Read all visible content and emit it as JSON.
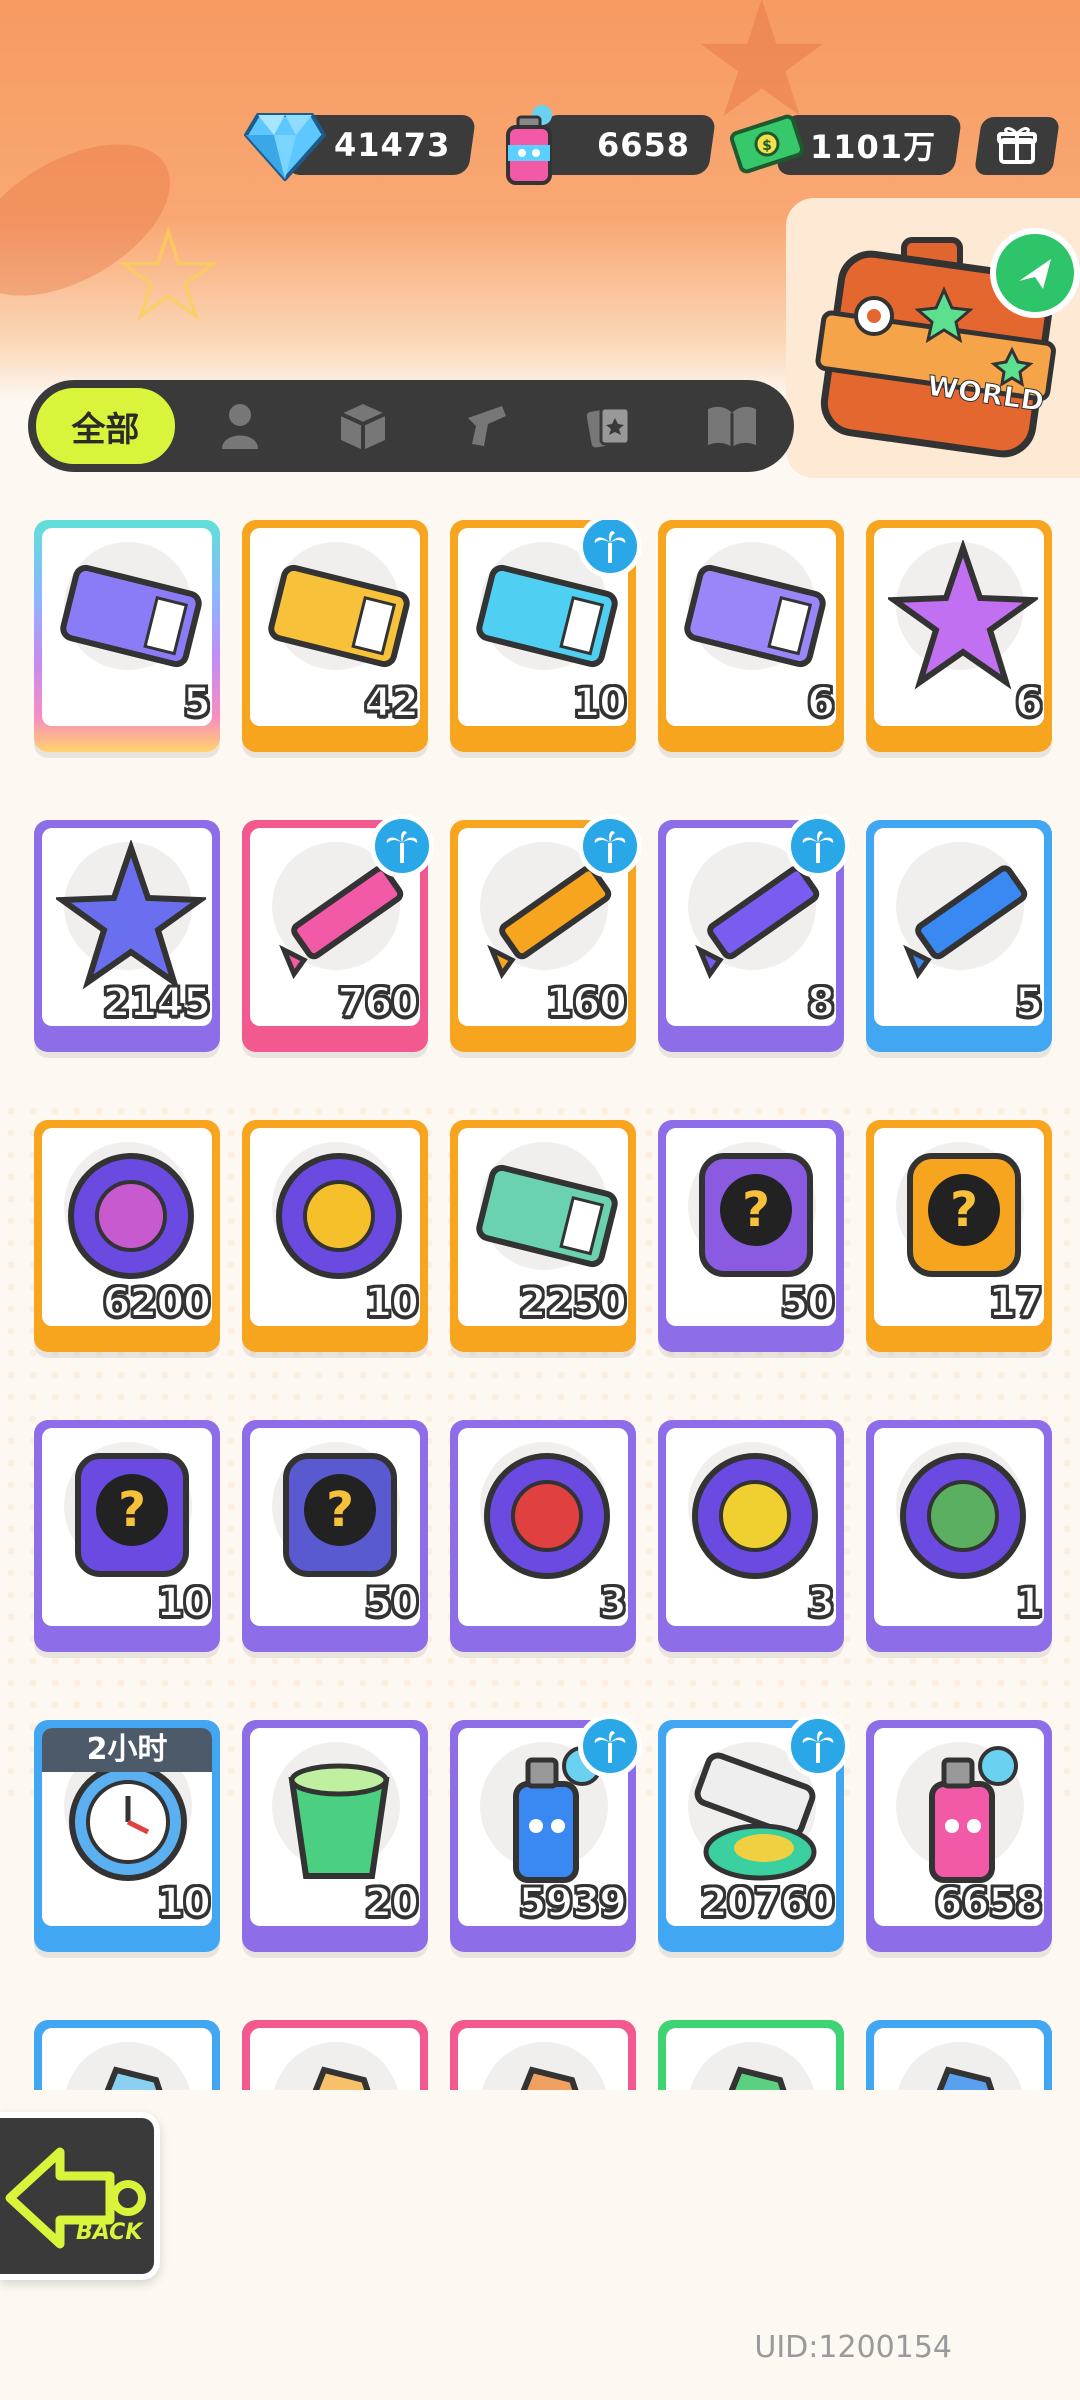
{
  "currencies": [
    {
      "icon": "diamond-icon",
      "value": "41473"
    },
    {
      "icon": "spray-can-icon",
      "value": "6658"
    },
    {
      "icon": "cash-icon",
      "value": "1101万"
    }
  ],
  "tabs": {
    "active_label": "全部",
    "icons": [
      "person-icon",
      "box-icon",
      "gun-icon",
      "cards-icon",
      "book-icon"
    ]
  },
  "world_label": "WORLD",
  "items": [
    {
      "name": "crown-ticket",
      "count": "5",
      "frame": "rainbow",
      "badge": false
    },
    {
      "name": "star-ticket",
      "count": "42",
      "frame": "orange",
      "badge": false
    },
    {
      "name": "wave-up-ticket",
      "count": "10",
      "frame": "orange",
      "badge": true
    },
    {
      "name": "purple-star-ticket",
      "count": "6",
      "frame": "orange",
      "badge": false
    },
    {
      "name": "rainbow-star",
      "count": "6",
      "frame": "orange",
      "badge": false
    },
    {
      "name": "blue-star",
      "count": "2145",
      "frame": "purple",
      "badge": false
    },
    {
      "name": "pink-crayon",
      "count": "760",
      "frame": "pink",
      "badge": true
    },
    {
      "name": "orange-crayon",
      "count": "160",
      "frame": "orange",
      "badge": true
    },
    {
      "name": "purple-crayon",
      "count": "8",
      "frame": "purple",
      "badge": true
    },
    {
      "name": "blue-crayon",
      "count": "5",
      "frame": "blue",
      "badge": false
    },
    {
      "name": "cool-badge",
      "count": "6200",
      "frame": "orange",
      "badge": false
    },
    {
      "name": "explosion-badge",
      "count": "10",
      "frame": "orange",
      "badge": false
    },
    {
      "name": "season-ticket",
      "count": "2250",
      "frame": "orange",
      "badge": false
    },
    {
      "name": "mystery-egg",
      "count": "50",
      "frame": "purple",
      "badge": false
    },
    {
      "name": "deity-mystery-gold",
      "count": "17",
      "frame": "orange",
      "badge": false
    },
    {
      "name": "deity-mystery-purple",
      "count": "10",
      "frame": "purple",
      "badge": false
    },
    {
      "name": "travel-card-mystery",
      "count": "50",
      "frame": "purple",
      "badge": false
    },
    {
      "name": "fish-pet-orb",
      "count": "3",
      "frame": "purple",
      "badge": false
    },
    {
      "name": "yellow-pet-orb",
      "count": "3",
      "frame": "purple",
      "badge": false
    },
    {
      "name": "plant-pet-orb",
      "count": "1",
      "frame": "purple",
      "badge": false
    },
    {
      "name": "alarm-clock",
      "count": "10",
      "frame": "blue",
      "badge": false,
      "timer": "2小时"
    },
    {
      "name": "green-cup",
      "count": "20",
      "frame": "purple",
      "badge": false
    },
    {
      "name": "blue-spray-can",
      "count": "5939",
      "frame": "purple",
      "badge": true
    },
    {
      "name": "paint-tube",
      "count": "20760",
      "frame": "blue",
      "badge": true
    },
    {
      "name": "pink-spray-can",
      "count": "6658",
      "frame": "purple",
      "badge": false
    },
    {
      "name": "partial-item-1",
      "count": "",
      "frame": "blue",
      "badge": false
    },
    {
      "name": "partial-item-2",
      "count": "",
      "frame": "pink",
      "badge": false
    },
    {
      "name": "partial-item-3",
      "count": "",
      "frame": "pink",
      "badge": false
    },
    {
      "name": "partial-item-4",
      "count": "",
      "frame": "green",
      "badge": false
    },
    {
      "name": "partial-item-5",
      "count": "",
      "frame": "blue",
      "badge": false
    }
  ],
  "back_label": "BACK",
  "uid": "UID:1200154"
}
